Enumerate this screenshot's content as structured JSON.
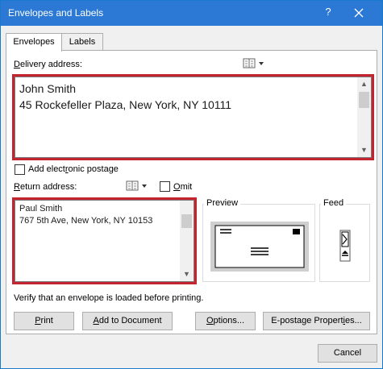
{
  "window": {
    "title": "Envelopes and Labels",
    "help": "?"
  },
  "tabs": [
    {
      "label": "Envelopes",
      "active": true
    },
    {
      "label": "Labels",
      "active": false
    }
  ],
  "delivery": {
    "label_prefix": "D",
    "label_rest": "elivery address:",
    "lines": "John Smith\n45 Rockefeller Plaza, New York, NY 10111"
  },
  "postage": {
    "prefix": "Add elect",
    "underline": "r",
    "suffix": "onic postage",
    "checked": false
  },
  "return": {
    "label_prefix": "R",
    "label_rest": "eturn address:",
    "lines": "Paul Smith\n767 5th Ave, New York, NY 10153",
    "omit_prefix": "",
    "omit_underline": "O",
    "omit_suffix": "mit",
    "omit_checked": false
  },
  "preview": {
    "title": "Preview"
  },
  "feed": {
    "title": "Feed"
  },
  "notice": "Verify that an envelope is loaded before printing.",
  "buttons": {
    "print_u": "P",
    "print_rest": "rint",
    "add_pre": "",
    "add_u": "A",
    "add_rest": "dd to Document",
    "options_pre": "",
    "options_u": "O",
    "options_rest": "ptions...",
    "epost_pre": "E-postage Propert",
    "epost_u": "i",
    "epost_rest": "es...",
    "cancel": "Cancel"
  },
  "colors": {
    "titlebar": "#2b79d4",
    "highlight": "#c4242f"
  }
}
